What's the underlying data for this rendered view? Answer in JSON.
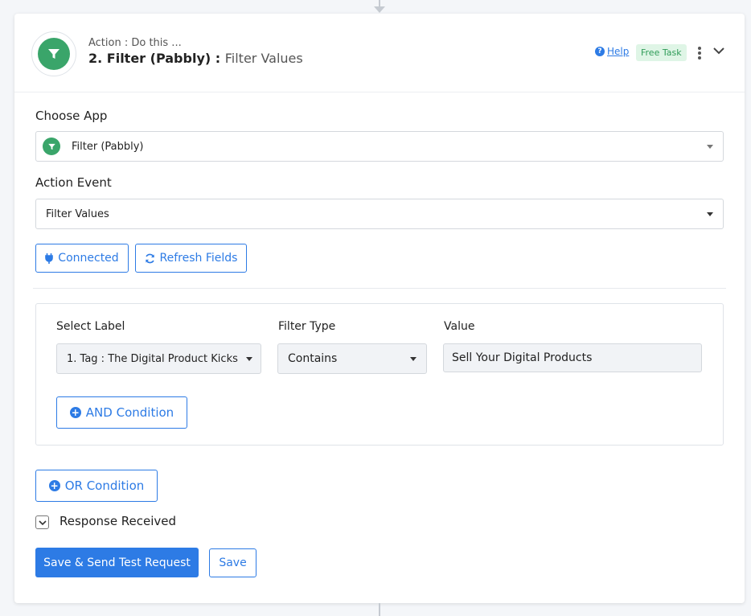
{
  "header": {
    "subtitle": "Action : Do this ...",
    "title": "2. Filter (Pabbly) :",
    "event": "Filter Values",
    "help_label": "Help",
    "badge": "Free Task",
    "app_icon": "filter-icon"
  },
  "choose_app": {
    "label": "Choose App",
    "value": "Filter (Pabbly)"
  },
  "action_event": {
    "label": "Action Event",
    "value": "Filter Values"
  },
  "buttons": {
    "connected": "Connected",
    "refresh": "Refresh Fields",
    "and_condition": "AND Condition",
    "or_condition": "OR Condition",
    "save_send": "Save & Send Test Request",
    "save": "Save"
  },
  "filter": {
    "select_label_header": "Select Label",
    "filter_type_header": "Filter Type",
    "value_header": "Value",
    "select_label_value": "1. Tag : The Digital Product Kicks",
    "filter_type_value": "Contains",
    "value_value": "Sell Your Digital Products"
  },
  "response": {
    "label": "Response Received",
    "checked": true
  },
  "colors": {
    "accent": "#2d7be5",
    "brand_green": "#3aa56a",
    "badge_bg": "#dff5e6",
    "badge_text": "#2f9c58"
  }
}
